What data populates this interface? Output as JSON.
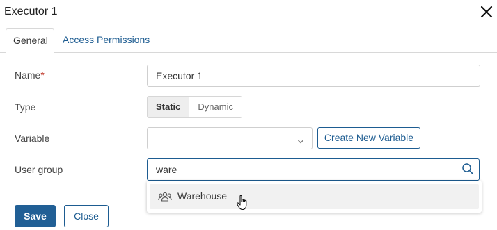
{
  "dialog": {
    "title": "Executor 1",
    "close_icon": "close-icon"
  },
  "tabs": [
    {
      "label": "General",
      "active": true
    },
    {
      "label": "Access Permissions",
      "active": false
    }
  ],
  "form": {
    "name": {
      "label": "Name",
      "required_mark": "*",
      "value": "Executor 1"
    },
    "type": {
      "label": "Type",
      "options": [
        "Static",
        "Dynamic"
      ],
      "selected": "Static"
    },
    "variable": {
      "label": "Variable",
      "value": "",
      "create_button": "Create New Variable"
    },
    "user_group": {
      "label": "User group",
      "value": "ware",
      "search_icon": "search-icon"
    }
  },
  "dropdown": {
    "items": [
      {
        "icon": "group-icon",
        "label": "Warehouse",
        "hovered": true
      }
    ]
  },
  "footer": {
    "save_label": "Save",
    "close_label": "Close"
  },
  "colors": {
    "accent": "#1d5c91",
    "primary_button": "#215f95",
    "required": "#c0392b"
  }
}
